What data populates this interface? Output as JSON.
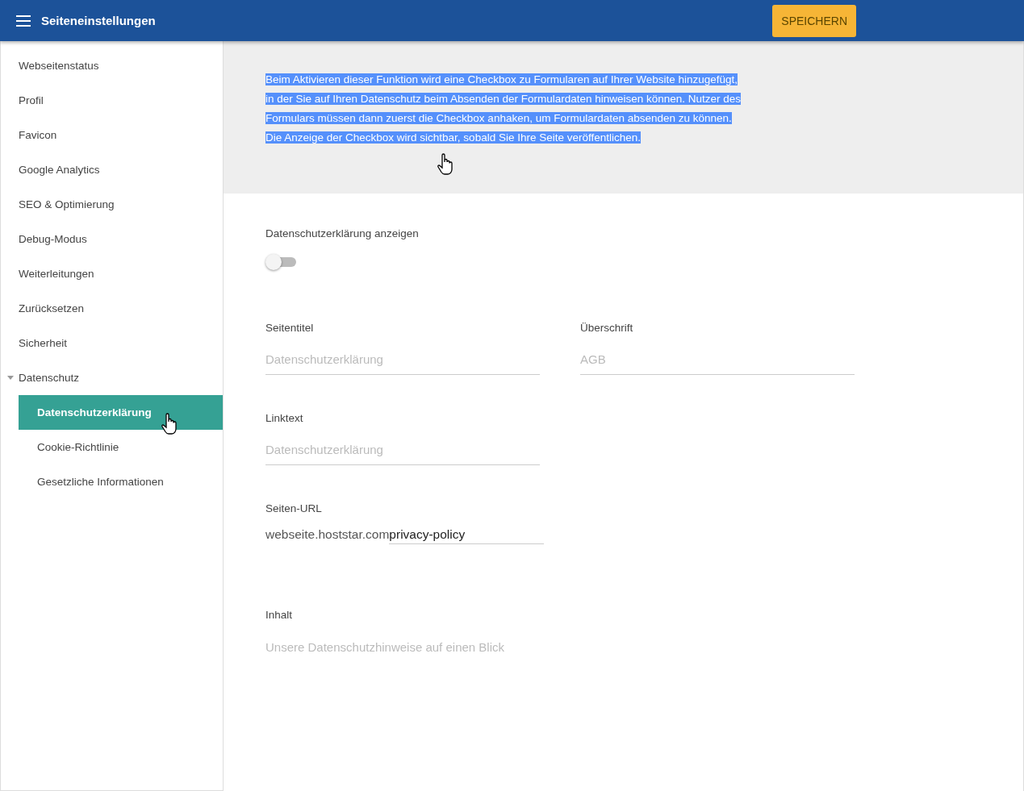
{
  "header": {
    "title": "Seiteneinstellungen",
    "save_button": "SPEICHERN"
  },
  "sidebar": {
    "items": [
      {
        "label": "Webseitenstatus",
        "selected": false
      },
      {
        "label": "Profil",
        "selected": false
      },
      {
        "label": "Favicon",
        "selected": false
      },
      {
        "label": "Google Analytics",
        "selected": false
      },
      {
        "label": "SEO & Optimierung",
        "selected": false
      },
      {
        "label": "Debug-Modus",
        "selected": false
      },
      {
        "label": "Weiterleitungen",
        "selected": false
      },
      {
        "label": "Zurücksetzen",
        "selected": false
      },
      {
        "label": "Sicherheit",
        "selected": false
      },
      {
        "label": "Datenschutz",
        "selected": false,
        "expanded": true,
        "children": [
          {
            "label": "Datenschutzerklärung",
            "selected": true
          },
          {
            "label": "Cookie-Richtlinie",
            "selected": false
          },
          {
            "label": "Gesetzliche Informationen",
            "selected": false
          }
        ]
      }
    ]
  },
  "info": {
    "text": "Beim Aktivieren dieser Funktion wird eine Checkbox zu Formularen auf Ihrer Website hinzugefügt, in der Sie auf Ihren Datenschutz beim Absenden der Formulardaten hinweisen können. Nutzer des Formulars müssen dann zuerst die Checkbox anhaken, um Formulardaten absenden zu können. Die Anzeige der Checkbox wird sichtbar, sobald Sie Ihre Seite veröffentlichen.",
    "text_selected": true
  },
  "toggle": {
    "label": "Datenschutzerklärung anzeigen",
    "on": false
  },
  "fields": {
    "page_title": {
      "label": "Seitentitel",
      "placeholder": "Datenschutzerklärung"
    },
    "heading": {
      "label": "Überschrift",
      "placeholder": "AGB"
    },
    "link_text": {
      "label": "Linktext",
      "placeholder": "Datenschutzerklärung"
    },
    "page_url": {
      "label": "Seiten-URL",
      "prefix": "webseite.hoststar.com",
      "value": "privacy-policy"
    },
    "content": {
      "label": "Inhalt",
      "placeholder": "Unsere Datenschutzhinweise auf einen Blick"
    }
  }
}
